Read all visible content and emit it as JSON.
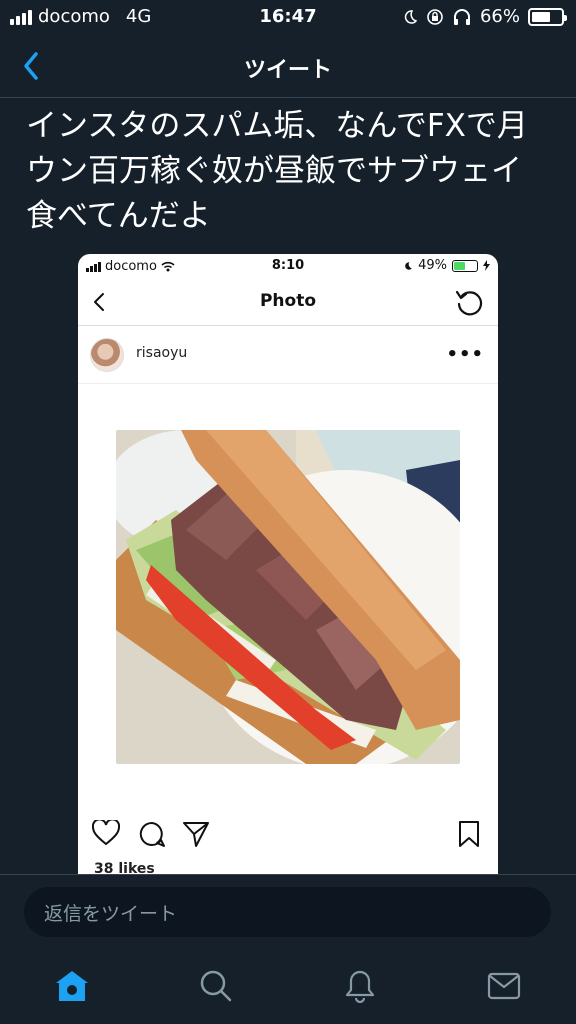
{
  "status_bar": {
    "carrier": "docomo",
    "network": "4G",
    "time": "16:47",
    "battery": "66%",
    "battery_level": 0.66
  },
  "nav": {
    "title": "ツイート"
  },
  "tweet": {
    "text_lines": [
      "インスタのスパム垢、なんでFXで月",
      "ウン百万稼ぐ奴が昼飯でサブウェイ",
      "食べてんだよ"
    ]
  },
  "embedded_screenshot": {
    "status": {
      "carrier": "docomo",
      "time": "8:10",
      "battery": "49%",
      "battery_level": 0.49
    },
    "nav_title": "Photo",
    "username": "risaoyu",
    "more_label": "•••",
    "likes": "38 likes",
    "icons": [
      "back-icon",
      "refresh-icon",
      "heart-icon",
      "comment-icon",
      "share-icon",
      "bookmark-icon"
    ]
  },
  "reply": {
    "placeholder": "返信をツイート"
  },
  "tabbar": {
    "items": [
      "home-icon",
      "search-icon",
      "notifications-icon",
      "messages-icon"
    ],
    "active": "home-icon"
  },
  "colors": {
    "background": "#15202b",
    "accent": "#1da1f2",
    "muted": "#8899a6",
    "divider": "#38444d"
  }
}
